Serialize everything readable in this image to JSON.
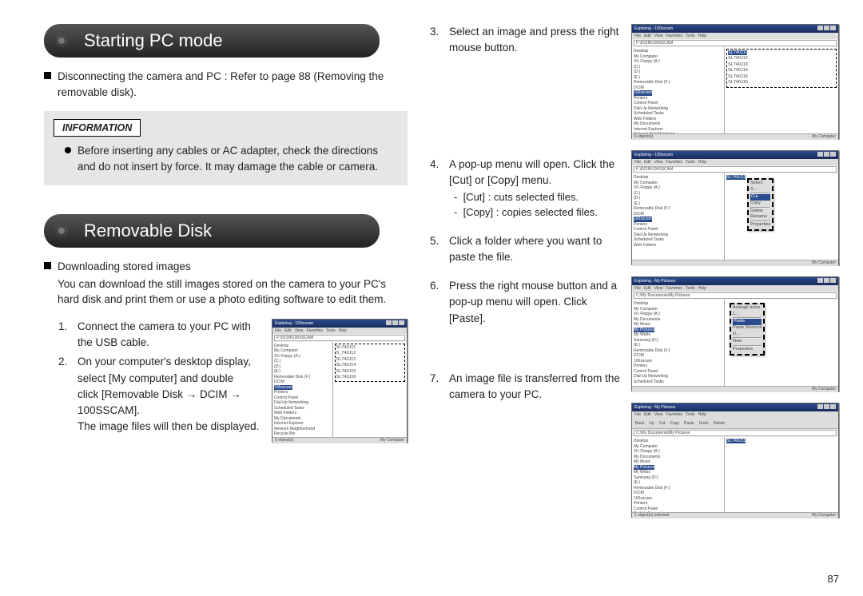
{
  "page_number": "87",
  "section1_title": "Starting PC mode",
  "section1_bullet": "Disconnecting the camera and PC : Refer to page 88 (Removing the removable disk).",
  "info_label": "INFORMATION",
  "info_item": "Before inserting any cables or AC adapter, check the directions and do not insert by force. It may damage the cable or camera.",
  "section2_title": "Removable Disk",
  "download_heading": "Downloading stored images",
  "download_intro": "You can download the still images stored on the camera to your PC's hard disk and print them or use a photo editing software to edit them.",
  "step1": "Connect the camera to your PC with the USB cable.",
  "step2_l1": "On your computer's desktop display, select [My computer] and double",
  "step2_l2": "click [Removable Disk → DCIM → 100SSCAM].",
  "step2_l3": "The image files will then be displayed.",
  "step3": "Select an image and press the right mouse button.",
  "step4": "A pop-up menu will open. Click the [Cut] or [Copy] menu.",
  "step4_sub1": "[Cut] : cuts selected files.",
  "step4_sub2": "[Copy] : copies selected files.",
  "step5": "Click a folder where you want to paste the file.",
  "step6": "Press the right mouse button and a pop-up menu will open. Click [Paste].",
  "step7": "An image file is transferred from the camera to your PC.",
  "fig": {
    "titlebar": "Exploring - 100sscam",
    "menus": [
      "File",
      "Edit",
      "View",
      "Favorites",
      "Tools",
      "Help"
    ],
    "address1": "F:\\DCIM\\100SSCAM",
    "tree_lines": [
      "Desktop",
      " My Computer",
      "  3½ Floppy (A:)",
      "  (C:)",
      "  (D:)",
      "  (E:)",
      "  Removable Disk (F:)",
      "   DCIM",
      "    100sscam",
      "  Printers",
      "  Control Panel",
      "  Dial-Up Networking",
      "  Scheduled Tasks",
      "  Web Folders",
      " My Documents",
      " Internet Explorer",
      " Network Neighborhood",
      " Recycle Bin"
    ],
    "files_a": [
      "SL740J11",
      "S_740J12",
      "SL740J13",
      "SL740J14",
      "SL740J15",
      "SL740J16"
    ],
    "files_b": [
      "SL740J11",
      "SL740J12",
      "SL740J13",
      "SL740J14",
      "SL740J15",
      "SL740J16"
    ],
    "status_left": "6 object(s)",
    "status_right": "My Computer",
    "ctx1": [
      "Select",
      "S ..",
      "Cut",
      "Copy",
      "...",
      "Delete",
      "Rename",
      "Properties"
    ],
    "ctx2_title": "Exploring - My Pictures",
    "ctx2_tree": [
      "Desktop",
      " My Computer",
      "  3½ Floppy (A:)",
      "  My Documents",
      "   My Music",
      "   My Pictures",
      "   My Webs",
      "  Samsung (D:)",
      "  (E:)",
      "  Removable Disk (F:)",
      "   DCIM",
      "    100sscam",
      "  Printers",
      "  Control Panel",
      "  Dial-Up Networking",
      "  Scheduled Tasks"
    ],
    "ctx2_items": [
      "Arrange Icons",
      "L...",
      "Paste",
      "Paste Shortcut",
      "U...",
      "New",
      "Properties"
    ],
    "address2": "C:\\My Documents\\My Pictures",
    "file7": "SL740J11"
  }
}
